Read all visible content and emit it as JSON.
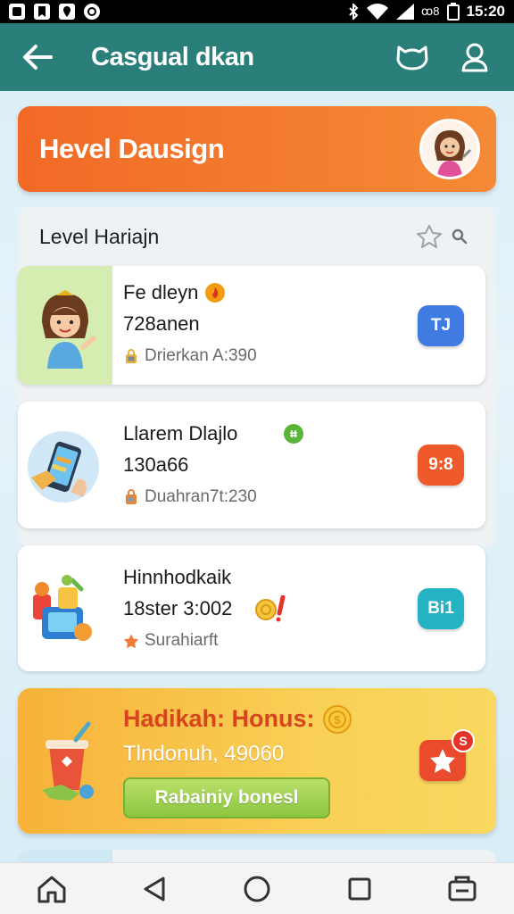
{
  "status_bar": {
    "time": "15:20",
    "signal_text": "ꝏ8"
  },
  "app_bar": {
    "title": "Casgual dkan",
    "back_icon": "arrow-left-icon",
    "action_icons": [
      "cat-mask-icon",
      "profile-icon"
    ]
  },
  "banner": {
    "title": "Hevel Dausign",
    "avatar_icon": "girl-avatar-icon"
  },
  "list": {
    "title": "Level Hariajn",
    "header_icons": [
      "star-outline-icon",
      "search-icon"
    ],
    "items": [
      {
        "name": "Fe dleyn",
        "value": "728anen",
        "meta": "Drierkan A:390",
        "badge": "TJ",
        "badge_color": "#3f7be0",
        "art_bg": "#d5edb0",
        "art_icon": "girl-character-icon",
        "meta_icon": "lock-icon",
        "name_icon": "fire-coin-icon"
      },
      {
        "name": "Llarem Dlajlo",
        "value": "130a66",
        "meta": "Duahran7t:230",
        "badge": "9:8",
        "badge_color": "#ee5a29",
        "art_bg": "#ffffff",
        "art_icon": "phone-hand-icon",
        "meta_icon": "bag-icon",
        "name_icon": "green-coin-icon"
      },
      {
        "name": "Hinnhodkaik",
        "value": "18ster 3:002",
        "meta": "Surahiarft",
        "badge": "Bi1",
        "badge_color": "#25b3c4",
        "art_bg": "#ffffff",
        "art_icon": "toys-pile-icon",
        "meta_icon": "star-icon",
        "name_icon": "coin-exclaim-icon"
      }
    ]
  },
  "bonus": {
    "title": "Hadikah: Honus:",
    "subtitle": "Tlndonuh, 49060",
    "button_label": "Rabainiy bonesl",
    "badge_count": "S",
    "art_icon": "soda-cup-icon",
    "coin_icon": "gold-coin-icon",
    "star_icon": "star-icon"
  },
  "nav": {
    "icons": [
      "home-icon",
      "back-triangle-icon",
      "home-circle-icon",
      "recents-square-icon",
      "screenshot-icon"
    ]
  },
  "colors": {
    "app_bar": "#2a7f7a",
    "banner": "#f26a26",
    "bonus": "#f7b23b"
  }
}
